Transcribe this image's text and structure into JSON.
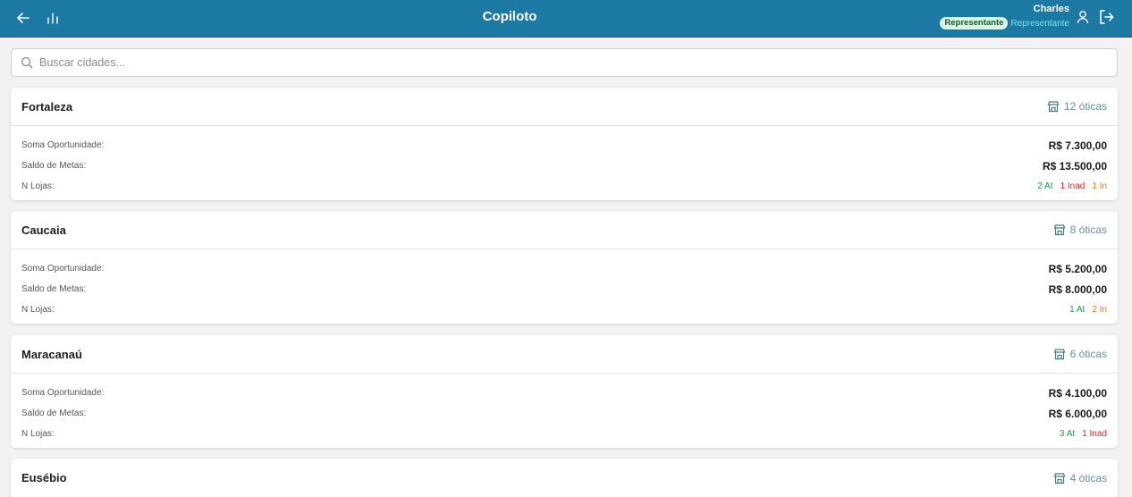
{
  "header": {
    "title": "Copiloto",
    "user_name": "Charles",
    "role_badge": "Representante",
    "role_text": "Representante"
  },
  "search": {
    "placeholder": "Buscar cidades..."
  },
  "labels": {
    "soma": "Soma Oportunidade:",
    "saldo": "Saldo de Metas:",
    "lojas": "N Lojas:"
  },
  "cities": [
    {
      "name": "Fortaleza",
      "count": "12 óticas",
      "soma": "R$ 7.300,00",
      "saldo": "R$ 13.500,00",
      "at": "2 At",
      "inad": "1 Inad",
      "in": "1 In"
    },
    {
      "name": "Caucaia",
      "count": "8 óticas",
      "soma": "R$ 5.200,00",
      "saldo": "R$ 8.000,00",
      "at": "1 At",
      "in": "2 In"
    },
    {
      "name": "Maracanaú",
      "count": "6 óticas",
      "soma": "R$ 4.100,00",
      "saldo": "R$ 6.000,00",
      "at": "3 At",
      "inad": "1 Inad"
    },
    {
      "name": "Eusébio",
      "count": "4 óticas"
    }
  ],
  "colors": {
    "header": "#1b79a4",
    "active": "#1e9c4a",
    "inadimplente": "#d9292e",
    "inativo": "#e07a1a"
  }
}
